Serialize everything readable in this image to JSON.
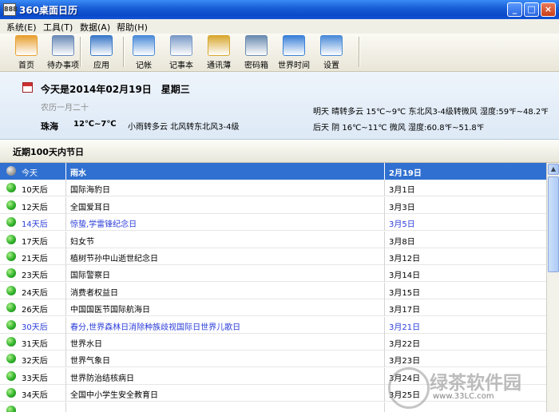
{
  "window": {
    "title": "360桌面日历",
    "icon_text": "888",
    "controls": {
      "minimize": "_",
      "maximize": "□",
      "close": "×"
    }
  },
  "menu": [
    {
      "label": "系统(E)"
    },
    {
      "label": "工具(T)"
    },
    {
      "label": "数据(A)"
    },
    {
      "label": "帮助(H)"
    }
  ],
  "toolbar": [
    {
      "label": "首页",
      "icon": "home-icon",
      "color": "#e8a030"
    },
    {
      "label": "待办事项",
      "icon": "todo-icon",
      "color": "#6a8ab8"
    },
    {
      "label": "应用",
      "icon": "apps-icon",
      "color": "#3a78c8"
    },
    {
      "label": "记帐",
      "icon": "ledger-icon",
      "color": "#4a8ad8"
    },
    {
      "label": "记事本",
      "icon": "notebook-icon",
      "color": "#7a9ac8"
    },
    {
      "label": "通讯薄",
      "icon": "addressbook-icon",
      "color": "#d8a830"
    },
    {
      "label": "密码箱",
      "icon": "password-box-icon",
      "color": "#6a8ab0"
    },
    {
      "label": "世界时间",
      "icon": "world-time-icon",
      "color": "#3a80d8"
    },
    {
      "label": "设置",
      "icon": "settings-icon",
      "color": "#4a8ad8"
    }
  ],
  "info": {
    "today": "今天是2014年02月19日　星期三",
    "lunar": "农历一月二十",
    "tomorrow": "明天 晴转多云 15℃~9℃ 东北风3-4级转微风 湿度:59℉~48.2℉",
    "after_tomorrow": "后天 阴 16℃~11℃ 微风 湿度:60.8℉~51.8℉",
    "city": "珠海",
    "temp": "12℃~7℃",
    "weather": "小雨转多云 北风转东北风3-4级"
  },
  "section": {
    "title": "近期100天内节日"
  },
  "holidays": [
    {
      "days": "今天",
      "name": "雨水",
      "date": "2月19日",
      "style": "selected"
    },
    {
      "days": "10天后",
      "name": "国际海豹日",
      "date": "3月1日",
      "style": "normal"
    },
    {
      "days": "12天后",
      "name": "全国爱耳日",
      "date": "3月3日",
      "style": "normal"
    },
    {
      "days": "14天后",
      "name": "惊蛰,学雷锋纪念日",
      "date": "3月5日",
      "style": "highlight"
    },
    {
      "days": "17天后",
      "name": "妇女节",
      "date": "3月8日",
      "style": "normal"
    },
    {
      "days": "21天后",
      "name": "植树节孙中山逝世纪念日",
      "date": "3月12日",
      "style": "normal"
    },
    {
      "days": "23天后",
      "name": "国际警察日",
      "date": "3月14日",
      "style": "normal"
    },
    {
      "days": "24天后",
      "name": "消费者权益日",
      "date": "3月15日",
      "style": "normal"
    },
    {
      "days": "26天后",
      "name": "中国国医节国际航海日",
      "date": "3月17日",
      "style": "normal"
    },
    {
      "days": "30天后",
      "name": "春分,世界森林日消除种族歧视国际日世界儿歌日",
      "date": "3月21日",
      "style": "highlight"
    },
    {
      "days": "31天后",
      "name": "世界水日",
      "date": "3月22日",
      "style": "normal"
    },
    {
      "days": "32天后",
      "name": "世界气象日",
      "date": "3月23日",
      "style": "normal"
    },
    {
      "days": "33天后",
      "name": "世界防治结核病日",
      "date": "3月24日",
      "style": "normal"
    },
    {
      "days": "34天后",
      "name": "全国中小学生安全教育日",
      "date": "3月25日",
      "style": "normal"
    },
    {
      "days": "",
      "name": "",
      "date": "",
      "style": "normal"
    }
  ],
  "watermark": {
    "brand": "绿茶软件园",
    "url": "www.33LC.com"
  }
}
